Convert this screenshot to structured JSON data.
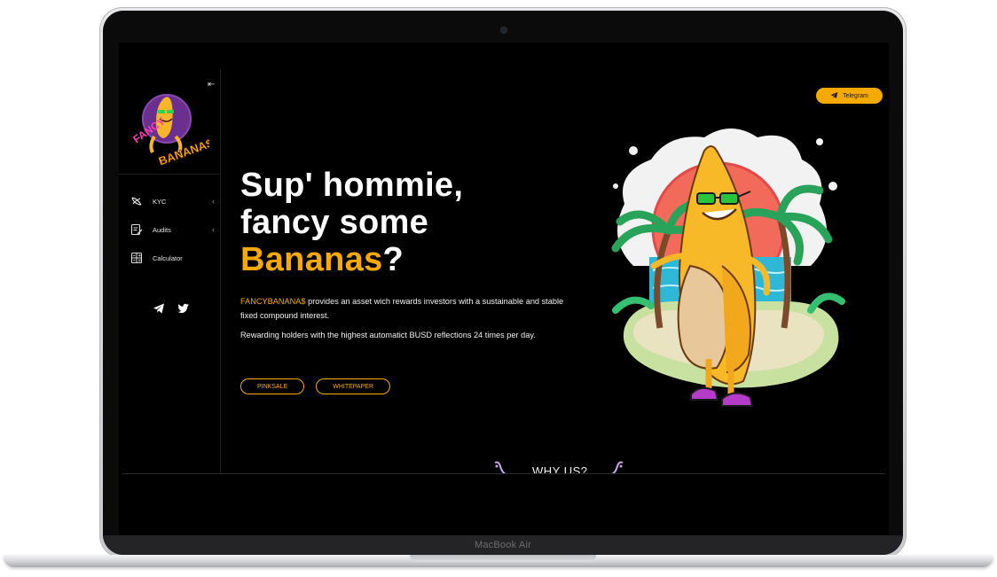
{
  "laptop": {
    "model_label": "MacBook Air"
  },
  "sidebar": {
    "logo_text": "FANCY BANANA$",
    "items": [
      {
        "label": "KYC",
        "icon": "banana-icon",
        "has_submenu": true
      },
      {
        "label": "Audits",
        "icon": "audit-edit-icon",
        "has_submenu": true
      },
      {
        "label": "Calculator",
        "icon": "calculator-icon",
        "has_submenu": false
      }
    ],
    "socials": [
      "telegram-icon",
      "twitter-icon"
    ]
  },
  "header": {
    "telegram_label": "Telegram"
  },
  "hero": {
    "line1": "Sup' hommie,",
    "line2": "fancy some",
    "accent_word": "Bananas",
    "question_mark": "?",
    "brand": "FANCYBANANA$",
    "desc1": " provides an asset wich rewards investors with a sustainable and stable fixed compound interest.",
    "desc2": "Rewarding holders with the highest automatict BUSD reflections 24 times per day.",
    "btn_pinksale": "PINKSALE",
    "btn_whitepaper": "WHITEPAPER"
  },
  "section": {
    "why_title": "WHY US?"
  },
  "colors": {
    "accent": "#f5a905",
    "background": "#000000",
    "text": "#ffffff"
  }
}
